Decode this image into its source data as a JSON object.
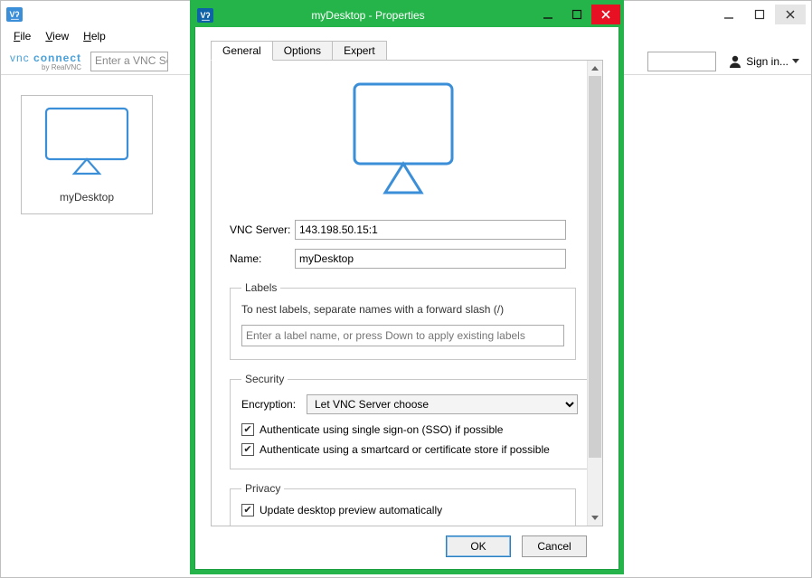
{
  "backWindow": {
    "menu": {
      "file": "File",
      "view": "View",
      "help": "Help"
    },
    "brand": {
      "line1_a": "vnc ",
      "line1_b": "connect",
      "line2": "by RealVNC"
    },
    "search_placeholder": "Enter a VNC Server address or search",
    "signin": "Sign in..."
  },
  "card": {
    "label": "myDesktop"
  },
  "dialog": {
    "title": "myDesktop - Properties",
    "tabs": {
      "general": "General",
      "options": "Options",
      "expert": "Expert"
    },
    "vnc_server": {
      "label": "VNC Server:",
      "value": "143.198.50.15:1"
    },
    "name": {
      "label": "Name:",
      "value": "myDesktop"
    },
    "labels": {
      "legend": "Labels",
      "help": "To nest labels, separate names with a forward slash (/)",
      "placeholder": "Enter a label name, or press Down to apply existing labels"
    },
    "security": {
      "legend": "Security",
      "encryption_label": "Encryption:",
      "encryption_value": "Let VNC Server choose",
      "sso": "Authenticate using single sign-on (SSO) if possible",
      "card": "Authenticate using a smartcard or certificate store if possible"
    },
    "privacy": {
      "legend": "Privacy",
      "update": "Update desktop preview automatically"
    },
    "buttons": {
      "ok": "OK",
      "cancel": "Cancel"
    }
  }
}
